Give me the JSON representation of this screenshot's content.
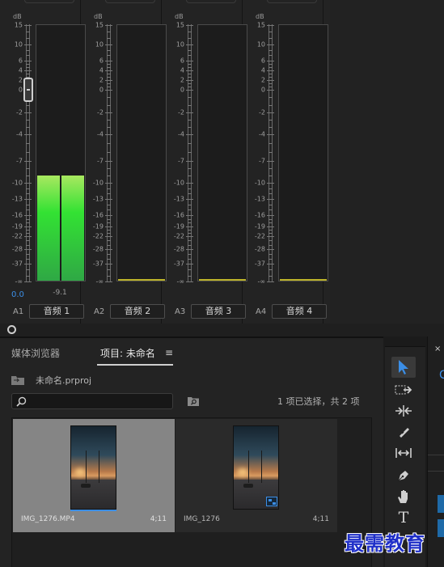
{
  "mixer": {
    "db_unit": "dB",
    "scale_labels": [
      "15",
      "10",
      "6",
      "4",
      "2",
      "0",
      "-2",
      "-4",
      "-7",
      "-10",
      "-13",
      "-16",
      "-19",
      "-22",
      "-28",
      "-37",
      "-∞"
    ],
    "channels": [
      {
        "id": "A1",
        "name": "音频 1",
        "volume": "0.0",
        "peak": "-9.1",
        "level_db": -9.1,
        "has_fader": true
      },
      {
        "id": "A2",
        "name": "音频 2",
        "volume": "",
        "peak": "",
        "level_db": null,
        "has_fader": false
      },
      {
        "id": "A3",
        "name": "音频 3",
        "volume": "",
        "peak": "",
        "level_db": null,
        "has_fader": false
      },
      {
        "id": "A4",
        "name": "音频 4",
        "volume": "",
        "peak": "",
        "level_db": null,
        "has_fader": false
      }
    ]
  },
  "project_panel": {
    "tabs": [
      {
        "label": "媒体浏览器",
        "active": false
      },
      {
        "label": "项目: 未命名",
        "active": true
      }
    ],
    "menu_icon": "≡",
    "project_file": "未命名.prproj",
    "search_placeholder": "",
    "selection_status": "1 项已选择，共 2 项",
    "items": [
      {
        "name": "IMG_1276.MP4",
        "duration": "4;11",
        "selected": true,
        "kind": "clip"
      },
      {
        "name": "IMG_1276",
        "duration": "4;11",
        "selected": false,
        "kind": "sequence"
      }
    ]
  },
  "tools": {
    "items": [
      "selection-tool",
      "track-select-tool",
      "ripple-edit-tool",
      "razor-tool",
      "slip-tool",
      "pen-tool",
      "hand-tool",
      "type-tool"
    ],
    "active": "selection-tool",
    "type_glyph": "T"
  },
  "right_panel": {
    "close_glyph": "×",
    "partial_text": "C"
  },
  "watermark": "最需教育",
  "colors": {
    "accent": "#3b8ee6",
    "meter_green": "#33e233",
    "meter_floor": "#bdb42a",
    "watermark": "#1f2fc8"
  }
}
